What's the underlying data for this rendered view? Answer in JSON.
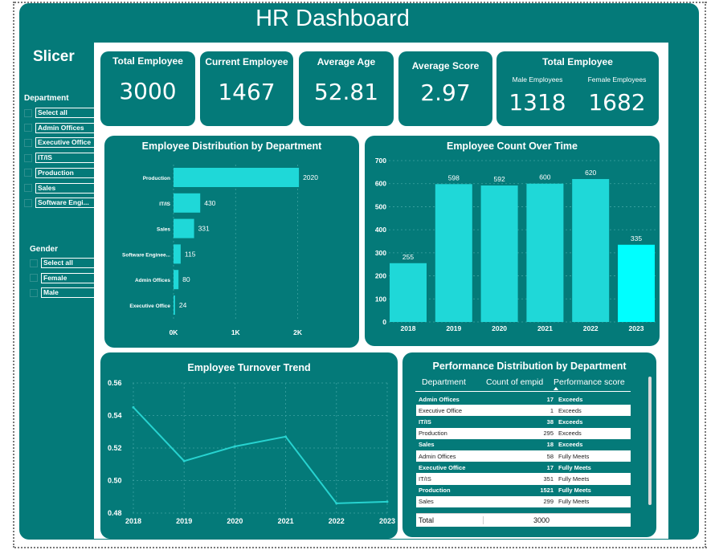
{
  "dashboard": {
    "title": "HR Dashboard"
  },
  "slicer": {
    "title": "Slicer",
    "department": {
      "heading": "Department",
      "items": [
        "Select all",
        "Admin Offices",
        "Executive Office",
        "IT/IS",
        "Production",
        "Sales",
        "Software Engi..."
      ]
    },
    "gender": {
      "heading": "Gender",
      "items": [
        "Select all",
        "Female",
        "Male"
      ]
    }
  },
  "kpis": {
    "total_employee": {
      "title": "Total Employee",
      "value": "3000"
    },
    "current_employee": {
      "title": "Current Employee",
      "value": "1467"
    },
    "average_age": {
      "title": "Average Age",
      "value": "52.81"
    },
    "average_score": {
      "title": "Average Score",
      "value": "2.97"
    },
    "gender_split": {
      "title": "Total Employee",
      "male_label": "Male Employees",
      "male_value": "1318",
      "female_label": "Female Employees",
      "female_value": "1682"
    }
  },
  "performance_table": {
    "title": "Performance Distribution by Department",
    "columns": [
      "Department",
      "Count of empid",
      "Performance score"
    ],
    "rows": [
      {
        "dept": "Admin Offices",
        "count": "17",
        "score": "Exceeds"
      },
      {
        "dept": "Executive Office",
        "count": "1",
        "score": "Exceeds"
      },
      {
        "dept": "IT/IS",
        "count": "38",
        "score": "Exceeds"
      },
      {
        "dept": "Production",
        "count": "295",
        "score": "Exceeds"
      },
      {
        "dept": "Sales",
        "count": "18",
        "score": "Exceeds"
      },
      {
        "dept": "Admin Offices",
        "count": "58",
        "score": "Fully Meets"
      },
      {
        "dept": "Executive Office",
        "count": "17",
        "score": "Fully Meets"
      },
      {
        "dept": "IT/IS",
        "count": "351",
        "score": "Fully Meets"
      },
      {
        "dept": "Production",
        "count": "1521",
        "score": "Fully Meets"
      },
      {
        "dept": "Sales",
        "count": "299",
        "score": "Fully Meets"
      }
    ],
    "total_label": "Total",
    "total_value": "3000"
  },
  "colors": {
    "teal": "#047a79",
    "bar": "#1fd8d8",
    "bar_highlight": "#00ffff",
    "line": "#27d3d0"
  },
  "chart_data": [
    {
      "type": "bar",
      "orientation": "horizontal",
      "title": "Employee Distribution by Department",
      "categories": [
        "Production",
        "IT/IS",
        "Sales",
        "Software Enginee...",
        "Admin Offices",
        "Executive Office"
      ],
      "values": [
        2020,
        430,
        331,
        115,
        80,
        24
      ],
      "x_ticks": [
        "0K",
        "1K",
        "2K"
      ],
      "xlim": [
        0,
        2200
      ]
    },
    {
      "type": "bar",
      "title": "Employee Count Over Time",
      "categories": [
        "2018",
        "2019",
        "2020",
        "2021",
        "2022",
        "2023"
      ],
      "values": [
        255,
        598,
        592,
        600,
        620,
        335
      ],
      "ylim": [
        0,
        700
      ],
      "y_ticks": [
        0,
        100,
        200,
        300,
        400,
        500,
        600,
        700
      ]
    },
    {
      "type": "line",
      "title": "Employee Turnover Trend",
      "x": [
        "2018",
        "2019",
        "2020",
        "2021",
        "2022",
        "2023"
      ],
      "y": [
        0.545,
        0.512,
        0.521,
        0.527,
        0.486,
        0.487
      ],
      "ylim": [
        0.48,
        0.56
      ],
      "y_ticks": [
        "0.56",
        "0.54",
        "0.52",
        "0.50",
        "0.48"
      ]
    }
  ]
}
